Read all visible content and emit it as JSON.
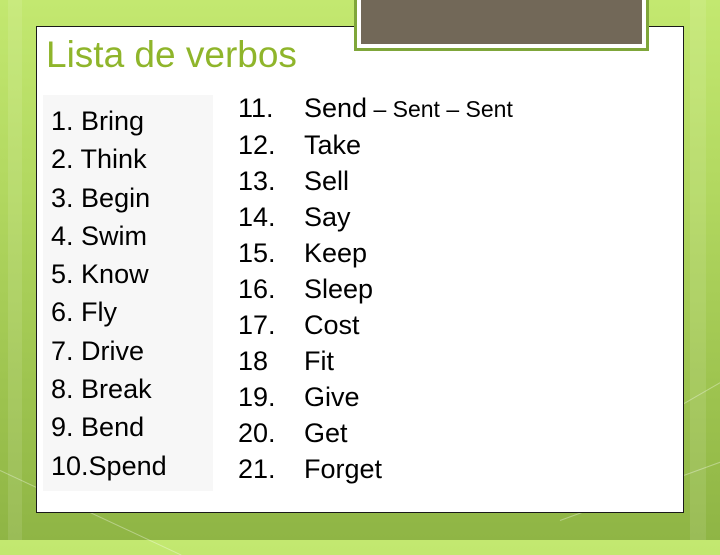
{
  "slide": {
    "title": "Lista de verbos",
    "colors": {
      "background": "#b2d860",
      "title": "#8fb52b",
      "accent_box": "#726858",
      "accent_border": "#7fa63a",
      "panel": "#ffffff",
      "text": "#000000"
    },
    "left_list": [
      {
        "num": "1.",
        "verb": "Bring"
      },
      {
        "num": "2.",
        "verb": "Think"
      },
      {
        "num": "3.",
        "verb": "Begin"
      },
      {
        "num": "4.",
        "verb": "Swim"
      },
      {
        "num": "5.",
        "verb": "Know"
      },
      {
        "num": "6.",
        "verb": "Fly"
      },
      {
        "num": "7.",
        "verb": "Drive"
      },
      {
        "num": "8.",
        "verb": "Break"
      },
      {
        "num": "9.",
        "verb": "Bend"
      },
      {
        "num": "10.",
        "verb": "Spend"
      }
    ],
    "right_list": [
      {
        "num": "11.",
        "verb": "Send",
        "extra": " – Sent – Sent"
      },
      {
        "num": "12.",
        "verb": "Take",
        "extra": ""
      },
      {
        "num": "13.",
        "verb": "Sell",
        "extra": ""
      },
      {
        "num": "14.",
        "verb": "Say",
        "extra": ""
      },
      {
        "num": "15.",
        "verb": "Keep",
        "extra": ""
      },
      {
        "num": "16.",
        "verb": "Sleep",
        "extra": ""
      },
      {
        "num": "17.",
        "verb": "Cost",
        "extra": ""
      },
      {
        "num": "18",
        "verb": "Fit",
        "extra": ""
      },
      {
        "num": "19.",
        "verb": "Give",
        "extra": ""
      },
      {
        "num": "20.",
        "verb": "Get",
        "extra": ""
      },
      {
        "num": "21.",
        "verb": "Forget",
        "extra": ""
      }
    ]
  }
}
